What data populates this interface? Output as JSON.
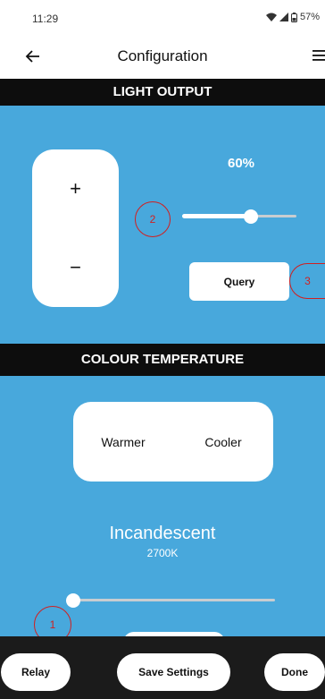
{
  "status_bar": {
    "time": "11:29",
    "battery": "57%"
  },
  "app_bar": {
    "title": "Configuration"
  },
  "light_output": {
    "header": "LIGHT OUTPUT",
    "plus_label": "+",
    "minus_label": "−",
    "level_text": "60%",
    "level_fraction": 0.6,
    "query_label": "Query"
  },
  "colour_temperature": {
    "header": "COLOUR TEMPERATURE",
    "warmer_label": "Warmer",
    "cooler_label": "Cooler",
    "preset_name": "Incandescent",
    "kelvin": "2700K",
    "slider_fraction": 0.0
  },
  "annotations": [
    "1",
    "2",
    "3"
  ],
  "bottom_bar": {
    "relay_label": "Relay",
    "save_label": "Save Settings",
    "done_label": "Done"
  },
  "colors": {
    "panel_blue": "#48a8dc",
    "header_black": "#0d0d0d",
    "annotation_red": "#d21f1f",
    "bottom_bar": "#1b1b1b"
  }
}
